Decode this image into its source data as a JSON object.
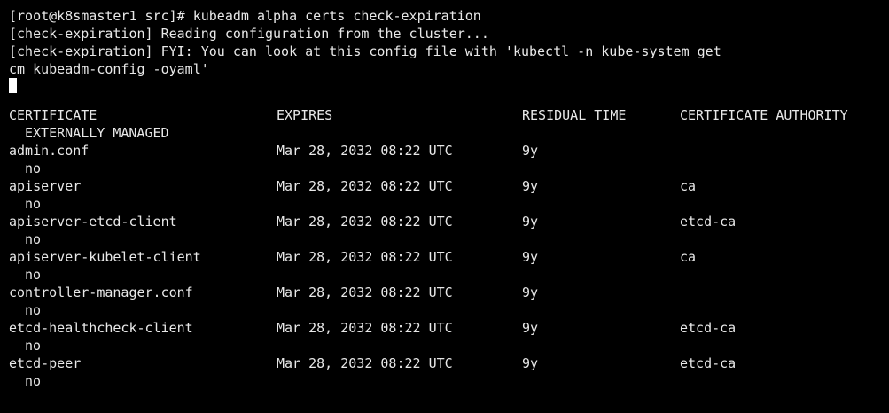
{
  "terminal": {
    "prompt_line": "[root@k8smaster1 src]# kubeadm alpha certs check-expiration",
    "output": [
      "[check-expiration] Reading configuration from the cluster...",
      "[check-expiration] FYI: You can look at this config file with 'kubectl -n kube-system get",
      "cm kubeadm-config -oyaml'"
    ],
    "table": {
      "headers": {
        "certificate": "CERTIFICATE",
        "expires": "EXPIRES",
        "residual_time": "RESIDUAL TIME",
        "certificate_authority": "CERTIFICATE AUTHORITY",
        "externally_managed": "EXTERNALLY MANAGED"
      },
      "rows": [
        {
          "certificate": "admin.conf",
          "expires": "Mar 28, 2032 08:22 UTC",
          "residual": "9y",
          "authority": "",
          "managed": "no"
        },
        {
          "certificate": "apiserver",
          "expires": "Mar 28, 2032 08:22 UTC",
          "residual": "9y",
          "authority": "ca",
          "managed": "no"
        },
        {
          "certificate": "apiserver-etcd-client",
          "expires": "Mar 28, 2032 08:22 UTC",
          "residual": "9y",
          "authority": "etcd-ca",
          "managed": "no"
        },
        {
          "certificate": "apiserver-kubelet-client",
          "expires": "Mar 28, 2032 08:22 UTC",
          "residual": "9y",
          "authority": "ca",
          "managed": "no"
        },
        {
          "certificate": "controller-manager.conf",
          "expires": "Mar 28, 2032 08:22 UTC",
          "residual": "9y",
          "authority": "",
          "managed": "no"
        },
        {
          "certificate": "etcd-healthcheck-client",
          "expires": "Mar 28, 2032 08:22 UTC",
          "residual": "9y",
          "authority": "etcd-ca",
          "managed": "no"
        },
        {
          "certificate": "etcd-peer",
          "expires": "Mar 28, 2032 08:22 UTC",
          "residual": "9y",
          "authority": "etcd-ca",
          "managed": "no"
        }
      ]
    }
  }
}
